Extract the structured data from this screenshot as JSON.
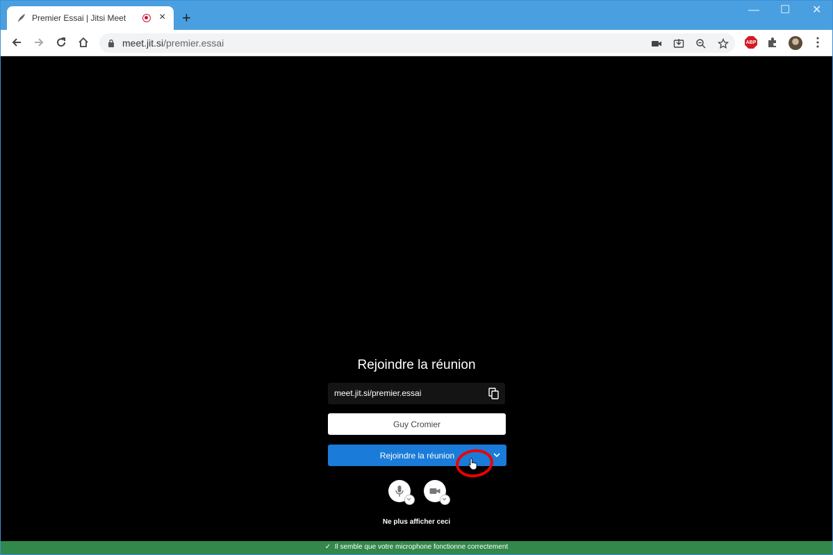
{
  "browser": {
    "tab_title": "Premier Essai | Jitsi Meet",
    "tab_close": "×",
    "new_tab": "+",
    "url_host": "meet.jit.si",
    "url_path": "/premier.essai",
    "window_controls": {
      "minimize": "—",
      "maximize": "☐",
      "close": "✕"
    },
    "extension_abp_label": "ABP",
    "accent_color": "#4a9fe0"
  },
  "prejoin": {
    "title": "Rejoindre la réunion",
    "meeting_link": "meet.jit.si/premier.essai",
    "name_value": "Guy Cromier",
    "join_label": "Rejoindre la réunion",
    "dont_show_again": "Ne plus afficher ceci",
    "join_color": "#1a7bd9"
  },
  "status": {
    "check": "✓",
    "message": "Il semble que votre microphone fonctionne correctement",
    "color": "#31884a"
  }
}
